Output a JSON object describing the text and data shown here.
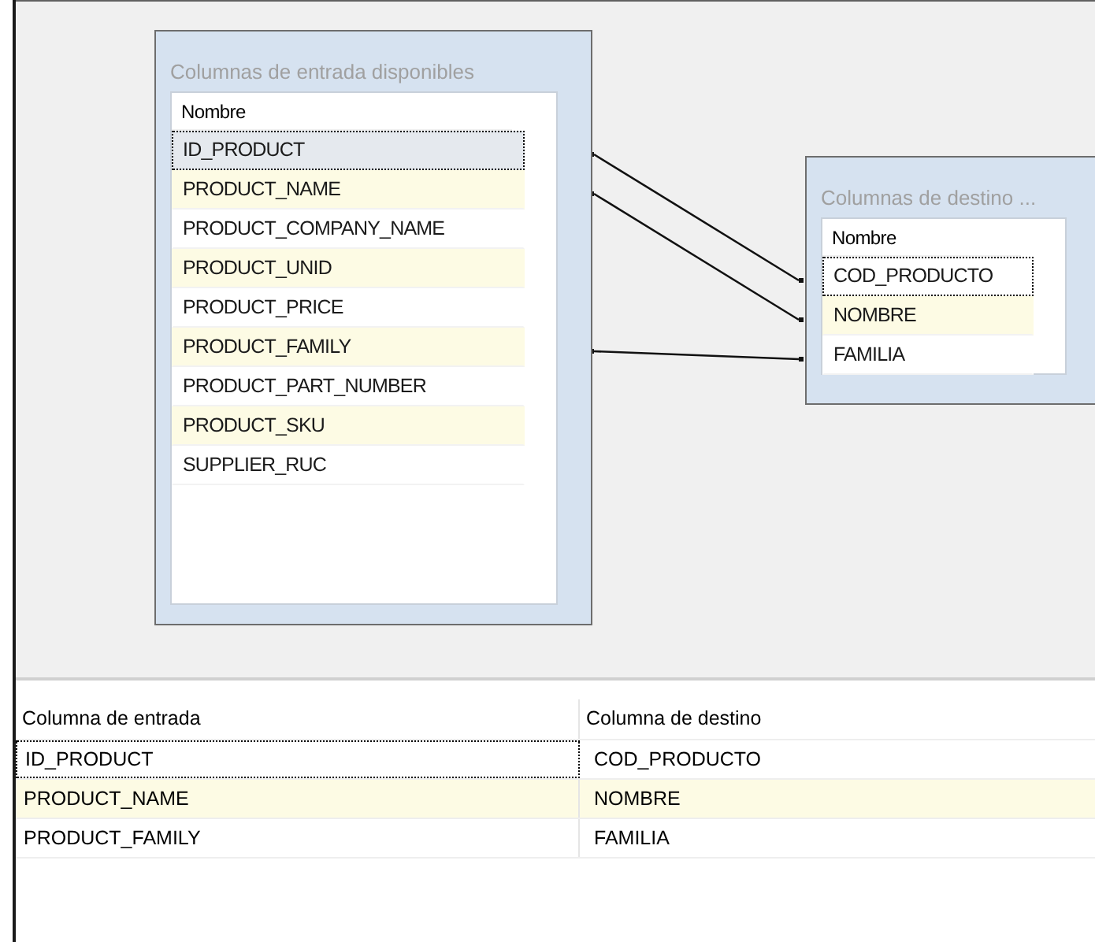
{
  "input_box": {
    "title": "Columnas de entrada disponibles",
    "header": "Nombre",
    "columns": [
      {
        "name": "ID_PRODUCT",
        "selected": true,
        "focused": true,
        "linked": true
      },
      {
        "name": "PRODUCT_NAME",
        "selected": false,
        "focused": false,
        "linked": true
      },
      {
        "name": "PRODUCT_COMPANY_NAME",
        "selected": false,
        "focused": false,
        "linked": false
      },
      {
        "name": "PRODUCT_UNID",
        "selected": false,
        "focused": false,
        "linked": false
      },
      {
        "name": "PRODUCT_PRICE",
        "selected": false,
        "focused": false,
        "linked": false
      },
      {
        "name": "PRODUCT_FAMILY",
        "selected": false,
        "focused": false,
        "linked": true
      },
      {
        "name": "PRODUCT_PART_NUMBER",
        "selected": false,
        "focused": false,
        "linked": false
      },
      {
        "name": "PRODUCT_SKU",
        "selected": false,
        "focused": false,
        "linked": false
      },
      {
        "name": "SUPPLIER_RUC",
        "selected": false,
        "focused": false,
        "linked": false
      }
    ]
  },
  "destination_box": {
    "title": "Columnas de destino ...",
    "header": "Nombre",
    "columns": [
      {
        "name": "COD_PRODUCTO",
        "selected": false,
        "focused": true,
        "linked": true
      },
      {
        "name": "NOMBRE",
        "selected": false,
        "focused": false,
        "linked": true
      },
      {
        "name": "FAMILIA",
        "selected": false,
        "focused": false,
        "linked": true
      }
    ]
  },
  "mapping_table": {
    "columns": [
      "Columna de entrada",
      "Columna de destino"
    ],
    "rows": [
      {
        "input": "ID_PRODUCT",
        "destination": "COD_PRODUCTO",
        "focused": true
      },
      {
        "input": "PRODUCT_NAME",
        "destination": "NOMBRE",
        "focused": false
      },
      {
        "input": "PRODUCT_FAMILY",
        "destination": "FAMILIA",
        "focused": false
      }
    ]
  }
}
